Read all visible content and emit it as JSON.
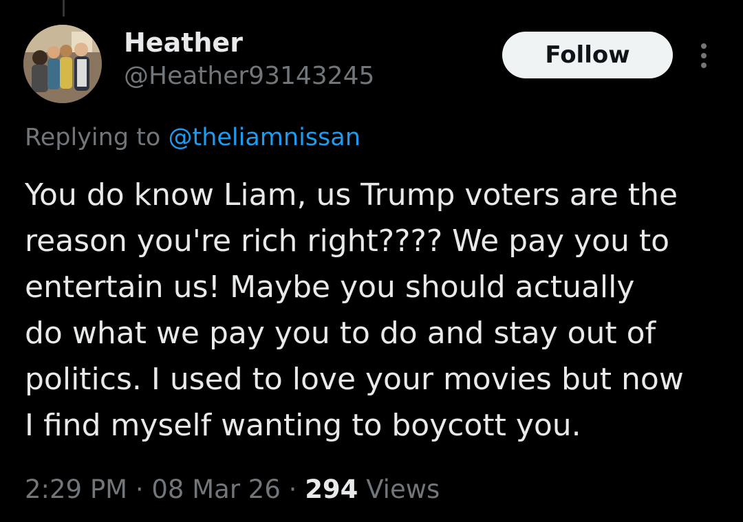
{
  "tweet": {
    "author": {
      "display_name": "Heather",
      "handle": "@Heather93143245"
    },
    "follow_label": "Follow",
    "more_icon": "more-vertical-icon",
    "replying": {
      "prefix": "Replying to",
      "handle": "@theliamnissan"
    },
    "text_lines": [
      "You do know Liam, us Trump voters are the",
      "reason you're rich right???? We pay you to",
      "entertain us! Maybe you should actually",
      "do what we pay you to do and stay out of",
      "politics. I used to love your movies but now",
      "I find myself wanting to boycott you."
    ],
    "meta": {
      "time": "2:29 PM",
      "separator": "·",
      "date": "08 Mar 26",
      "views_count": "294",
      "views_label": "Views"
    }
  },
  "colors": {
    "background": "#000000",
    "primary_text": "#e7e9ea",
    "secondary_text": "#71767b",
    "link": "#1d9bf0",
    "follow_bg": "#eff3f4"
  }
}
